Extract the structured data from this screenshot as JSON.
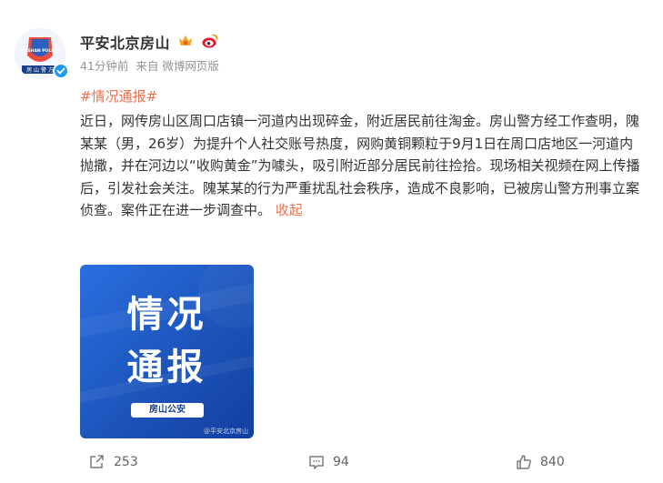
{
  "post": {
    "author": "平安北京房山",
    "time": "41分钟前",
    "source_prefix": "来自",
    "source": "微博网页版",
    "hashtag": "#情况通报#",
    "text": "近日，网传房山区周口店镇一河道内出现碎金，附近居民前往淘金。房山警方经工作查明，隗某某（男，26岁）为提升个人社交账号热度，网购黄铜颗粒于9月1日在周口店地区一河道内抛撒，并在河边以“收购黄金”为噱头，吸引附近部分居民前往捡拾。现场相关视频在网上传播后，引发社会关注。隗某某的行为严重扰乱社会秩序，造成不良影响，已被房山警方刑事立案侦查。案件正在进一步调查中。",
    "collapse_label": "收起",
    "avatar_text": "FUSHAN POLICE",
    "avatar_bottom": "房 山 警 方"
  },
  "image": {
    "line1": "情况",
    "line2": "通报",
    "badge": "房山公安",
    "watermark": "@平安北京房山"
  },
  "actions": {
    "repost_count": "253",
    "comment_count": "94",
    "like_count": "840"
  },
  "colors": {
    "link": "#eb7350",
    "verified": "#1e9bf0",
    "image_bg": "#1c58c8"
  }
}
